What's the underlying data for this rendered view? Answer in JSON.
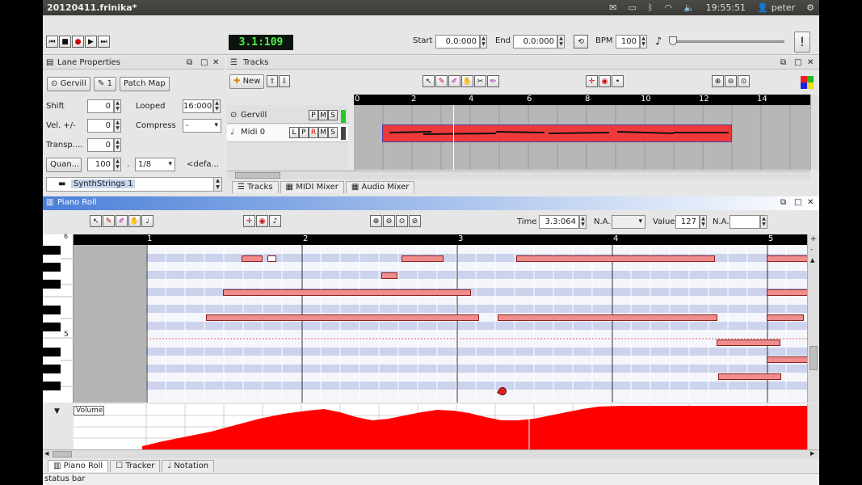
{
  "window": {
    "title": "20120411.frinika*"
  },
  "tray": {
    "time": "19:55:51",
    "user": "peter",
    "mail_icon": "mail-icon",
    "battery_icon": "battery-icon",
    "bluetooth_icon": "bluetooth-icon",
    "wifi_icon": "wifi-icon",
    "volume_icon": "speaker-icon",
    "gear_icon": "gear-icon"
  },
  "transport": {
    "position": "3.1:109",
    "start_label": "Start",
    "start_value": "0.0:000",
    "end_label": "End",
    "end_value": "0.0:000",
    "bpm_label": "BPM",
    "bpm_value": "100"
  },
  "lane_properties": {
    "title": "Lane Properties",
    "synth_button": "Gervill",
    "pencil_button": "1",
    "patch_map_button": "Patch Map",
    "shift_label": "Shift",
    "shift_value": "0",
    "looped_label": "Looped",
    "looped_value": "16:000",
    "vel_label": "Vel. +/-",
    "vel_value": "0",
    "compress_label": "Compress",
    "compress_value": "-",
    "transp_label": "Transp....",
    "transp_value": "0",
    "quant_button": "Quan...",
    "quant_value": "100",
    "quant_sep": ".",
    "quant_grid": "1/8",
    "quant_default": "<defa...",
    "instrument": "SynthStrings 1"
  },
  "tracks_panel": {
    "title": "Tracks",
    "new_button": "New",
    "ruler": [
      "0",
      "2",
      "4",
      "6",
      "8",
      "10",
      "12",
      "14"
    ],
    "lanes": [
      {
        "name": "Gervill",
        "buttons": [
          "P",
          "M",
          "S"
        ]
      },
      {
        "name": "Midi 0",
        "buttons": [
          "L",
          "P",
          "R",
          "M",
          "S"
        ]
      }
    ],
    "tabs": [
      "Tracks",
      "MIDI Mixer",
      "Audio Mixer"
    ]
  },
  "piano_roll": {
    "title": "Piano Roll",
    "time_label": "Time",
    "time_value": "3.3:064",
    "na_label1": "N.A.",
    "na_value1": "",
    "value_label": "Value",
    "value_value": "127",
    "na_label2": "N.A.",
    "na_value2": "",
    "ruler": [
      "1",
      "2",
      "3",
      "4",
      "5"
    ],
    "keyboard_top_label": "6",
    "keyboard_mid_label": "5",
    "controller": "Volume",
    "tabs": [
      "Piano Roll",
      "Tracker",
      "Notation"
    ]
  },
  "status_bar": "status bar"
}
